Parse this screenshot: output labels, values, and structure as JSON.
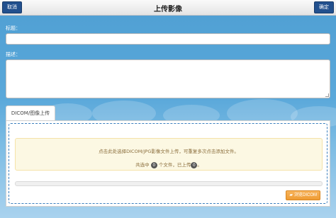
{
  "header": {
    "cancel_label": "取消",
    "title": "上传影像",
    "confirm_label": "确定"
  },
  "form": {
    "title_label": "标题：",
    "title_value": "",
    "description_label": "描述：",
    "description_value": ""
  },
  "tab": {
    "label": "DICOM/图像上传"
  },
  "upload": {
    "hint": "点击此处选择DICOM/JPG影像文件上传，可重复多次点击添加文件。",
    "count_prefix": "共选中",
    "selected_count": "0",
    "count_middle": "个文件，已上传",
    "uploaded_count": "0",
    "count_suffix": "。",
    "progress": 0,
    "browse_icon": "folder-icon",
    "browse_label": "浏览DICOM"
  },
  "colors": {
    "header_button": "#22508e",
    "page_background": "#5aa8da",
    "browse_button": "#f0a040",
    "notice_background": "#fcf8e3",
    "dropzone_border": "#3a7ebd"
  }
}
